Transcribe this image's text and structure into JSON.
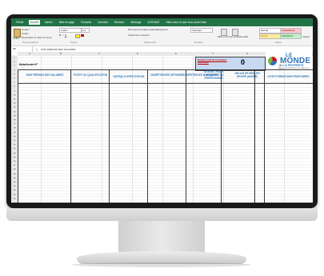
{
  "excel": {
    "tabs": [
      "Fichier",
      "Accueil",
      "Insérer",
      "Mise en page",
      "Formules",
      "Données",
      "Révision",
      "Affichage",
      "ACROBAT",
      "Dites-nous ce que vous voulez faire"
    ],
    "ribbon": {
      "clipboard": [
        "Couper",
        "Copier",
        "Reproduire la mise en forme"
      ],
      "paste_label": "Coller",
      "font": "Calibri",
      "font_size": "11",
      "wrap_text": "Renvoyer à la ligne automatiquement",
      "merge": "Fusionner et centrer",
      "number_format": "Standard",
      "cond_format": "Mise en forme conditionnelle",
      "table_format": "Mettre sous forme de tableau",
      "styles": [
        {
          "label": "Normal",
          "color": "#ffffff"
        },
        {
          "label": "Insatisfaisant",
          "color": "#ffc7ce"
        },
        {
          "label": "Neutre",
          "color": "#ffeb9c"
        },
        {
          "label": "Satisfaisant",
          "color": "#c6efce"
        }
      ],
      "insert_label": "Insérer",
      "groups": [
        "Presse-papiers",
        "Police",
        "Alignement",
        "Nombre",
        "Styles",
        "Cellules"
      ]
    },
    "name_box": "A5",
    "fx": "fx",
    "formula": "NOM PRENOM DES SALARIES",
    "columns": [
      "A",
      "B",
      "C",
      "D",
      "E",
      "F",
      "G",
      "H"
    ],
    "sheet": {
      "month_label": "Mois/Année N°",
      "counter_label": "Nombre total de formations exprimées",
      "counter_value": "0",
      "headers": [
        "NOM PRENOM DES SALARIES",
        "POSTE OU QUALIFICATION",
        "DATE(S) D'AFFECTATION",
        "COMPETENCES DETENUES",
        "COMPETENCES A ACQUERIR",
        "INTERET POUR FORMATION OU PROFESSIONS",
        "DELAIS DE MISE EN ŒUVRE (ANNEE)",
        "LISTE FORMATIONS PROPOSEES"
      ],
      "row_numbers": [
        "1",
        "2",
        "3",
        "4",
        "5",
        "6",
        "7",
        "8",
        "9",
        "10",
        "11",
        "12",
        "13",
        "14",
        "15",
        "16",
        "17",
        "18",
        "19",
        "20",
        "21",
        "22",
        "23",
        "24",
        "25",
        "26",
        "27",
        "28",
        "29",
        "30",
        "31",
        "32",
        "33",
        "34",
        "35"
      ]
    },
    "logo": {
      "line1": "LE",
      "line2": "MONDE",
      "line3": "de LA PROPRETE",
      "tagline": "Sauver la compétence en matière de propreté"
    },
    "accent": "#217346",
    "header_blue": "#2e75b6",
    "counter_bg": "#c6d9f1"
  }
}
